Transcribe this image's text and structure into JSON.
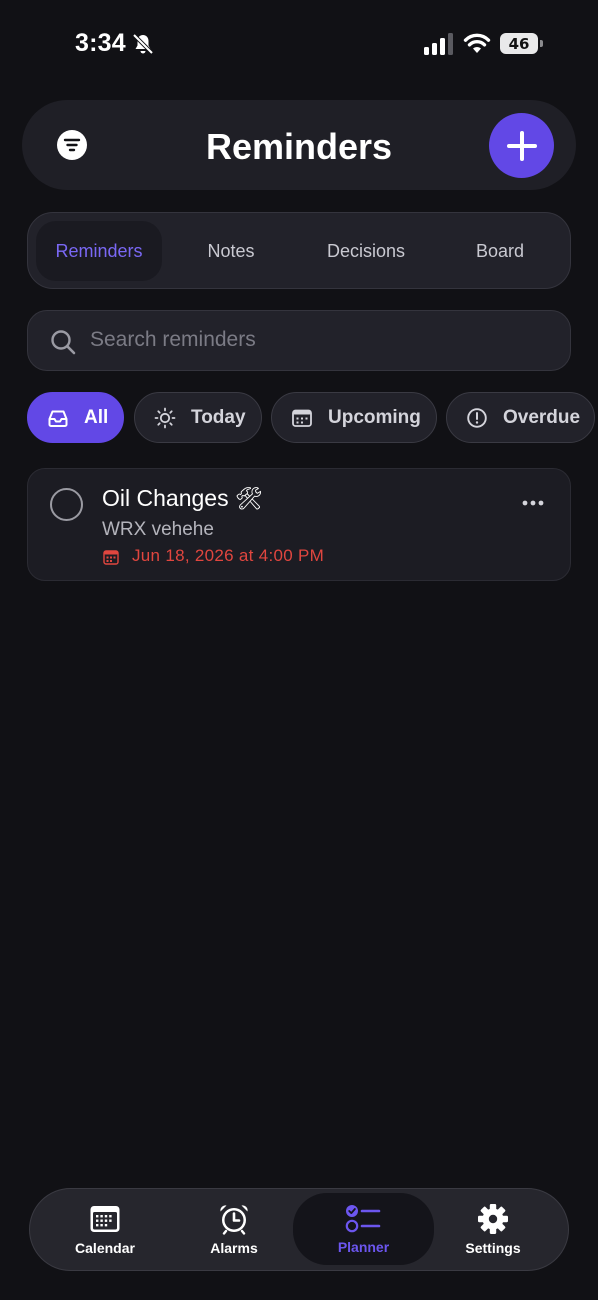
{
  "status_bar": {
    "time": "3:34",
    "battery": "46"
  },
  "header": {
    "title": "Reminders"
  },
  "segment_tabs": [
    {
      "label": "Reminders",
      "active": true
    },
    {
      "label": "Notes",
      "active": false
    },
    {
      "label": "Decisions",
      "active": false
    },
    {
      "label": "Board",
      "active": false
    }
  ],
  "search": {
    "placeholder": "Search reminders",
    "value": ""
  },
  "filter_chips": [
    {
      "label": "All",
      "icon": "inbox-icon",
      "active": true
    },
    {
      "label": "Today",
      "icon": "sun-icon",
      "active": false
    },
    {
      "label": "Upcoming",
      "icon": "calendar-icon",
      "active": false
    },
    {
      "label": "Overdue",
      "icon": "alert-circle-icon",
      "active": false
    }
  ],
  "reminders": [
    {
      "title": "Oil Changes",
      "emoji": "🛠",
      "note": "WRX vehehe",
      "due": "Jun 18, 2026 at 4:00 PM",
      "overdue": true
    }
  ],
  "bottom_nav": [
    {
      "label": "Calendar",
      "icon": "calendar-grid-icon",
      "active": false
    },
    {
      "label": "Alarms",
      "icon": "alarm-clock-icon",
      "active": false
    },
    {
      "label": "Planner",
      "icon": "checklist-icon",
      "active": true
    },
    {
      "label": "Settings",
      "icon": "gear-icon",
      "active": false
    }
  ],
  "colors": {
    "accent": "#6248e6",
    "background": "#111115",
    "overdue": "#e0463f"
  }
}
